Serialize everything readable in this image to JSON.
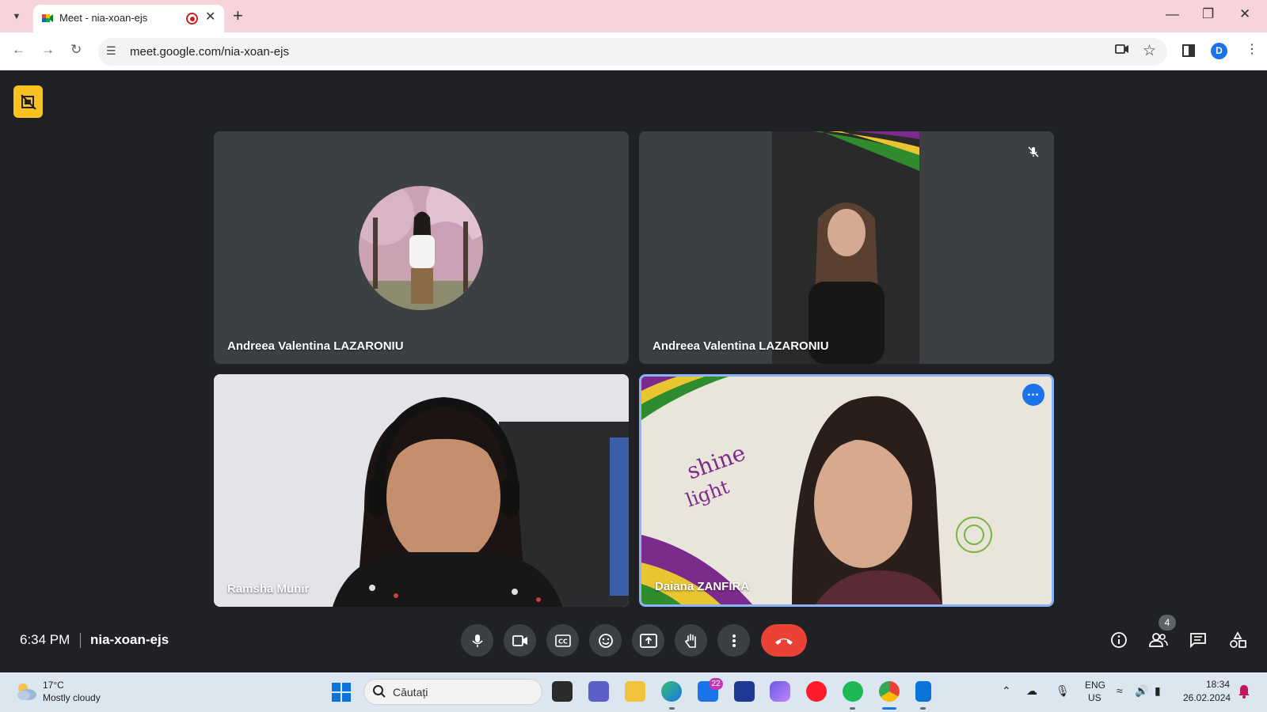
{
  "browser": {
    "tab_title": "Meet - nia-xoan-ejs",
    "url": "meet.google.com/nia-xoan-ejs",
    "profile_initial": "D"
  },
  "participants": [
    {
      "name": "Andreea Valentina LAZARONIU",
      "view": "avatar"
    },
    {
      "name": "Andreea Valentina LAZARONIU",
      "view": "video",
      "muted": true
    },
    {
      "name": "Ramsha Munir",
      "view": "video"
    },
    {
      "name": "Daiana ZANFIRA",
      "view": "video",
      "active_speaker": true
    }
  ],
  "meeting": {
    "time": "6:34 PM",
    "code": "nia-xoan-ejs",
    "participant_count": "4"
  },
  "controls": [
    "microphone",
    "camera",
    "captions",
    "reactions",
    "present-screen",
    "raise-hand",
    "more-options",
    "leave-call"
  ],
  "right_controls": [
    "meeting-info",
    "people",
    "chat",
    "activities"
  ],
  "taskbar": {
    "weather_temp": "17°C",
    "weather_desc": "Mostly cloudy",
    "search_placeholder": "Căutați",
    "mail_badge": "22",
    "lang_line1": "ENG",
    "lang_line2": "US",
    "time": "18:34",
    "date": "26.02.2024"
  },
  "colors": {
    "meet_bg": "#202124",
    "tile_bg": "#3c4043",
    "end_call": "#ea4335",
    "active_border": "#8ab4f8",
    "tab_bar": "#f7d3dc"
  }
}
